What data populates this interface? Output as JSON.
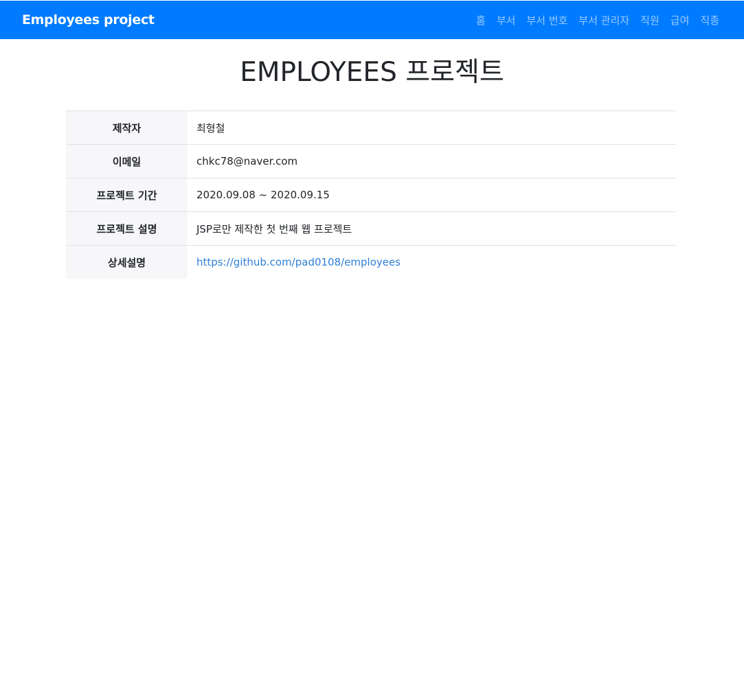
{
  "navbar": {
    "brand": "Employees project",
    "links": [
      {
        "label": "홈"
      },
      {
        "label": "부서"
      },
      {
        "label": "부서 번호"
      },
      {
        "label": "부서 관리자"
      },
      {
        "label": "직원"
      },
      {
        "label": "급여"
      },
      {
        "label": "직종"
      }
    ],
    "background": "#007bff"
  },
  "main": {
    "title": "EMPLOYEES 프로젝트",
    "rows": [
      {
        "label": "제작자",
        "value": "최형철"
      },
      {
        "label": "이메일",
        "value": "chkc78@naver.com"
      },
      {
        "label": "프로젝트 기간",
        "value": "2020.09.08 ~ 2020.09.15"
      },
      {
        "label": "프로젝트 설명",
        "value": "JSP로만 제작한 첫 번째 웹 프로젝트"
      },
      {
        "label": "상세설명",
        "value": "https://github.com/pad0108/employees"
      }
    ],
    "link_color": "#2f7fd6"
  }
}
